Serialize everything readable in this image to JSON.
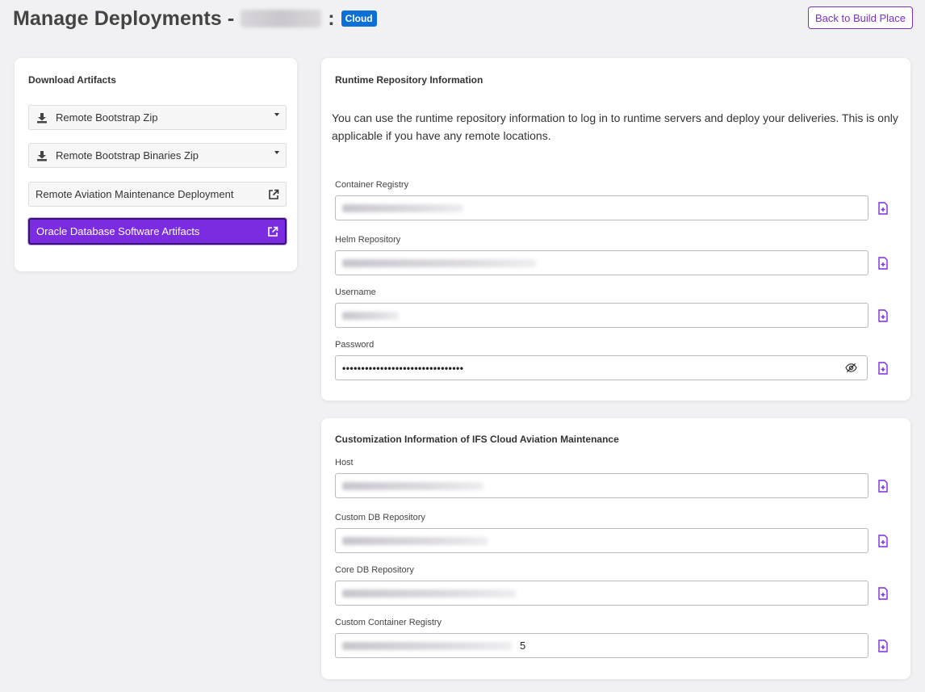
{
  "header": {
    "title": "Manage Deployments - ",
    "colon": ":",
    "badge": "Cloud",
    "back_button": "Back to Build Place"
  },
  "downloads": {
    "title": "Download Artifacts",
    "items": [
      {
        "label": "Remote Bootstrap Zip",
        "icon": "download-icon",
        "kind": "dropdown"
      },
      {
        "label": "Remote Bootstrap Binaries Zip",
        "icon": "download-icon",
        "kind": "dropdown"
      },
      {
        "label": "Remote Aviation Maintenance Deployment",
        "icon": "external-link-icon",
        "kind": "link"
      },
      {
        "label": "Oracle Database Software Artifacts",
        "icon": "external-link-icon",
        "kind": "link",
        "active": true
      }
    ]
  },
  "runtime": {
    "title": "Runtime Repository Information",
    "description": "You can use the runtime repository information to log in to runtime servers and deploy your deliveries. This is only applicable if you have any remote locations.",
    "fields": [
      {
        "label": "Container Registry"
      },
      {
        "label": "Helm Repository"
      },
      {
        "label": "Username"
      },
      {
        "label": "Password",
        "value": "••••••••••••••••••••••••••••••••"
      }
    ]
  },
  "custom": {
    "title": "Customization Information of IFS Cloud Aviation Maintenance",
    "fields": [
      {
        "label": "Host"
      },
      {
        "label": "Custom DB Repository"
      },
      {
        "label": "Core DB Repository"
      },
      {
        "label": "Custom Container Registry",
        "trailing": "5"
      }
    ]
  },
  "colors": {
    "accent": "#7b2be0",
    "badge": "#0a6fd6",
    "background": "#f1f0f3"
  }
}
